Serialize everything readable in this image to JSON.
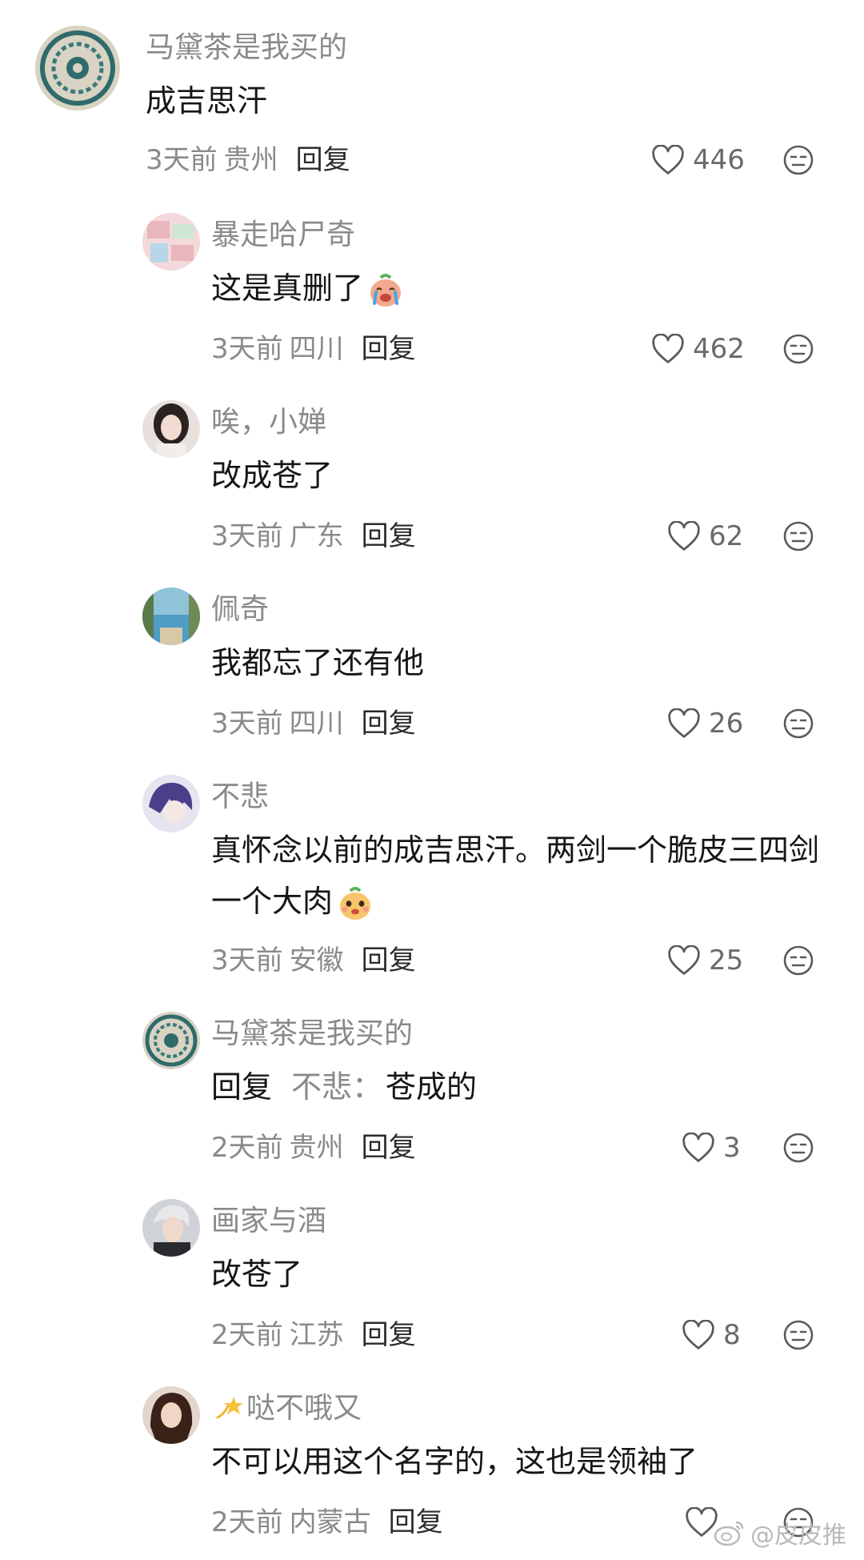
{
  "comments": [
    {
      "author": "马黛茶是我买的",
      "text": "成吉思汗",
      "time": "3天前",
      "location": "贵州",
      "reply_label": "回复",
      "likes": "446"
    },
    {
      "author": "暴走哈尸奇",
      "text": "这是真删了",
      "time": "3天前",
      "location": "四川",
      "reply_label": "回复",
      "likes": "462"
    },
    {
      "author": "唉，小婵",
      "text": "改成苍了",
      "time": "3天前",
      "location": "广东",
      "reply_label": "回复",
      "likes": "62"
    },
    {
      "author": "佩奇",
      "text": "我都忘了还有他",
      "time": "3天前",
      "location": "四川",
      "reply_label": "回复",
      "likes": "26"
    },
    {
      "author": "不悲",
      "text": "真怀念以前的成吉思汗。两剑一个脆皮三四剑一个大肉",
      "time": "3天前",
      "location": "安徽",
      "reply_label": "回复",
      "likes": "25"
    },
    {
      "author": "马黛茶是我买的",
      "reply_prefix": "回复",
      "reply_to": "不悲：",
      "text": "苍成的",
      "time": "2天前",
      "location": "贵州",
      "reply_label": "回复",
      "likes": "3"
    },
    {
      "author": "画家与酒",
      "text": "改苍了",
      "time": "2天前",
      "location": "江苏",
      "reply_label": "回复",
      "likes": "8"
    },
    {
      "author": "哒不哦又",
      "text": "不可以用这个名字的，这也是领袖了",
      "time": "2天前",
      "location": "内蒙古",
      "reply_label": "回复",
      "likes": ""
    }
  ],
  "watermark": "@皮皮推",
  "icons": {
    "like": "heart-outline-icon",
    "dislike": "neutral-face-icon",
    "weibo": "weibo-logo-icon"
  },
  "colors": {
    "text_primary": "#161616",
    "text_secondary": "#8a8a8a",
    "icon": "#6a6a6a"
  }
}
